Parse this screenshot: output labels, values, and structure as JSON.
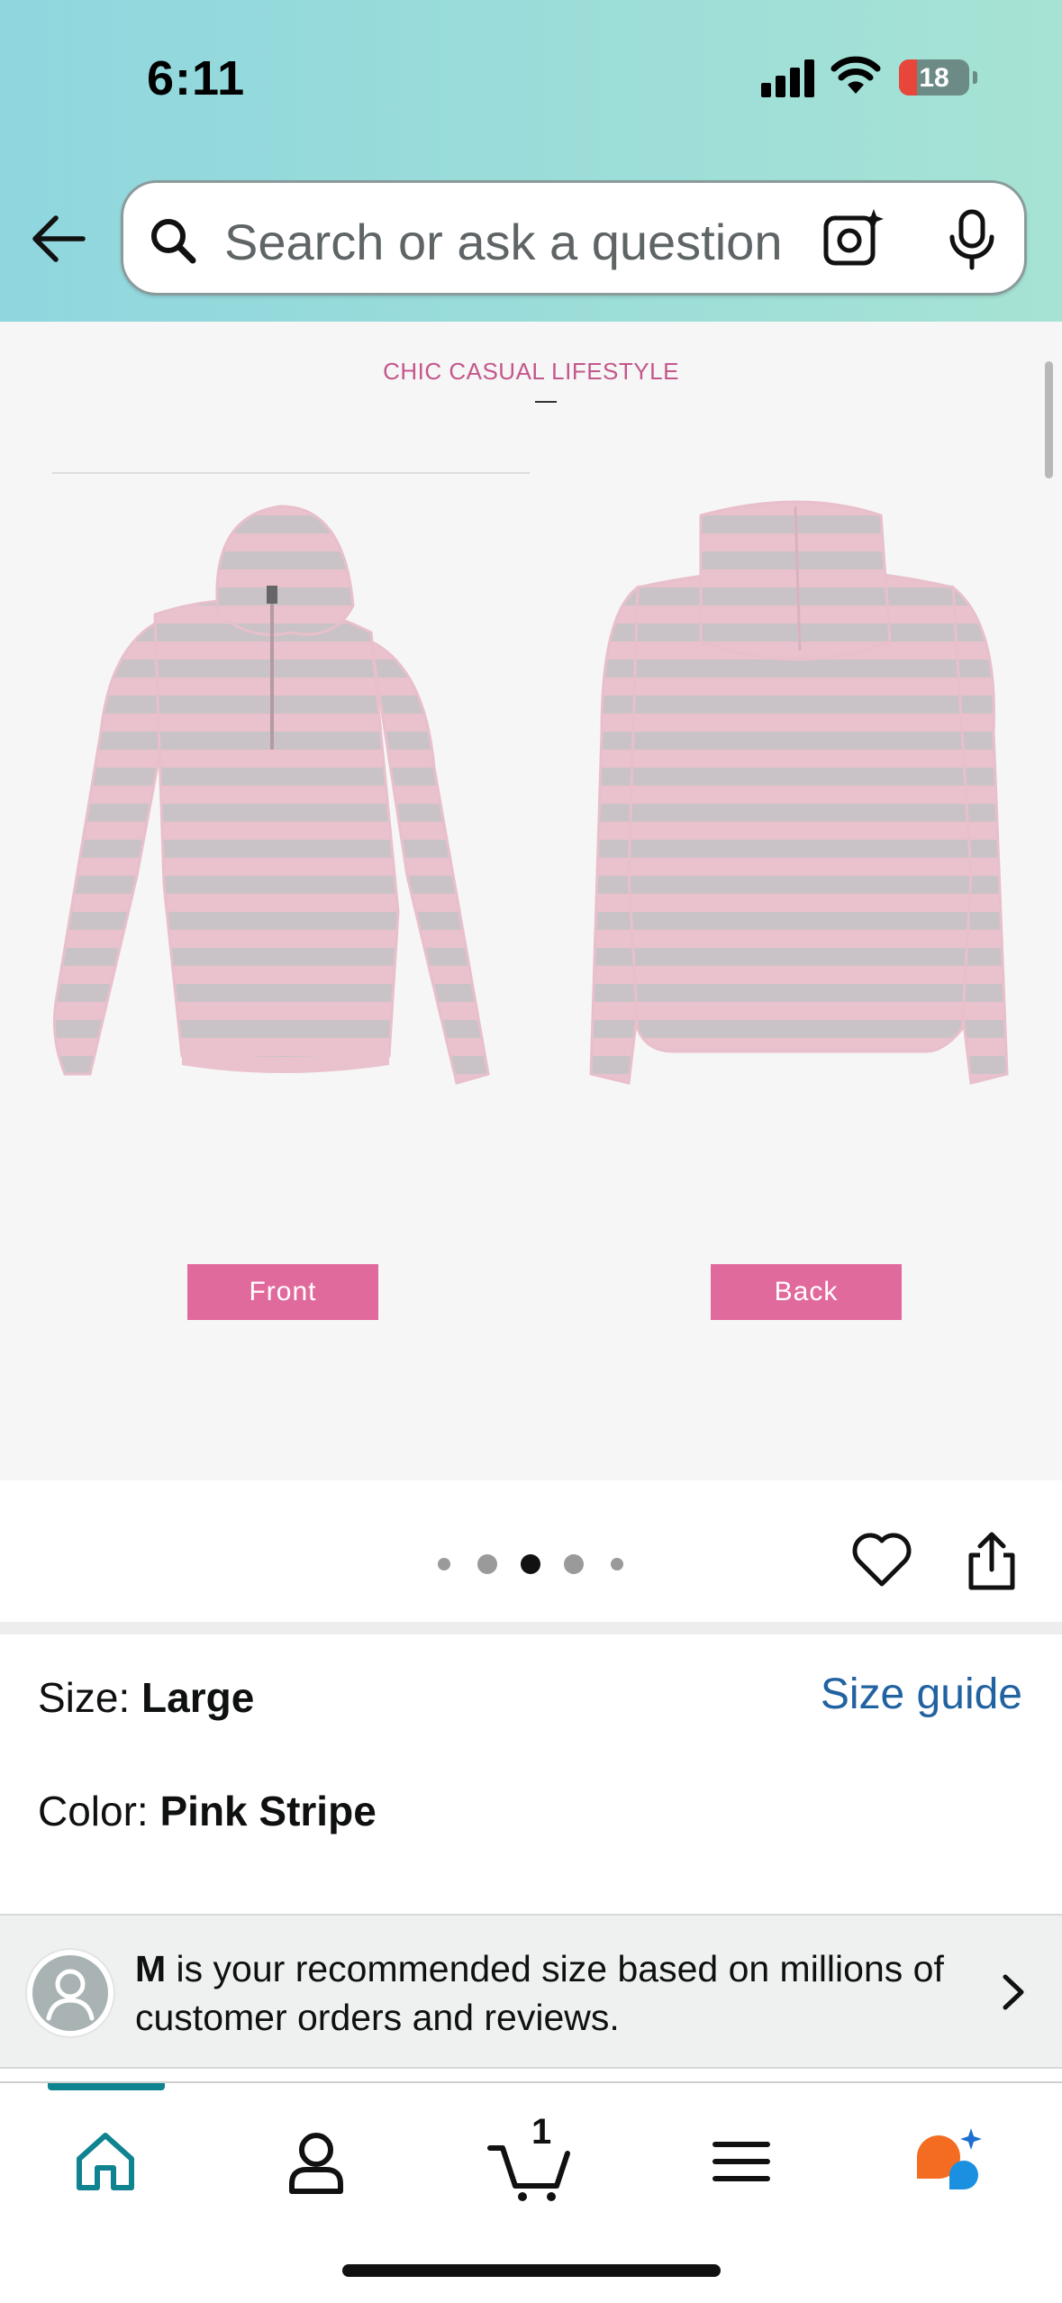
{
  "status_bar": {
    "time": "6:11",
    "battery_level": "18"
  },
  "search": {
    "placeholder": "Search or ask a question"
  },
  "product_image": {
    "caption": "CHIC CASUAL LIFESTYLE",
    "front_label": "Front",
    "back_label": "Back",
    "current_image_index": 3,
    "image_count": 5
  },
  "variations": {
    "size_label": "Size: ",
    "size_value": "Large",
    "size_guide_label": "Size guide",
    "color_label": "Color: ",
    "color_value": "Pink Stripe"
  },
  "recommendation": {
    "size": "M",
    "text": " is your recommended size based on millions of customer orders and reviews."
  },
  "cart": {
    "count": "1"
  },
  "icons": [
    "back-arrow-icon",
    "search-icon",
    "camera-icon",
    "microphone-icon",
    "heart-icon",
    "share-icon",
    "profile-icon",
    "chevron-right-icon",
    "home-icon",
    "account-icon",
    "cart-icon",
    "menu-icon",
    "rufus-ai-icon"
  ],
  "colors": {
    "header_gradient_start": "#8fd6de",
    "header_gradient_end": "#a6e3d4",
    "accent_teal": "#108391",
    "link_blue": "#2162a1",
    "label_pink": "#e16a9d"
  }
}
